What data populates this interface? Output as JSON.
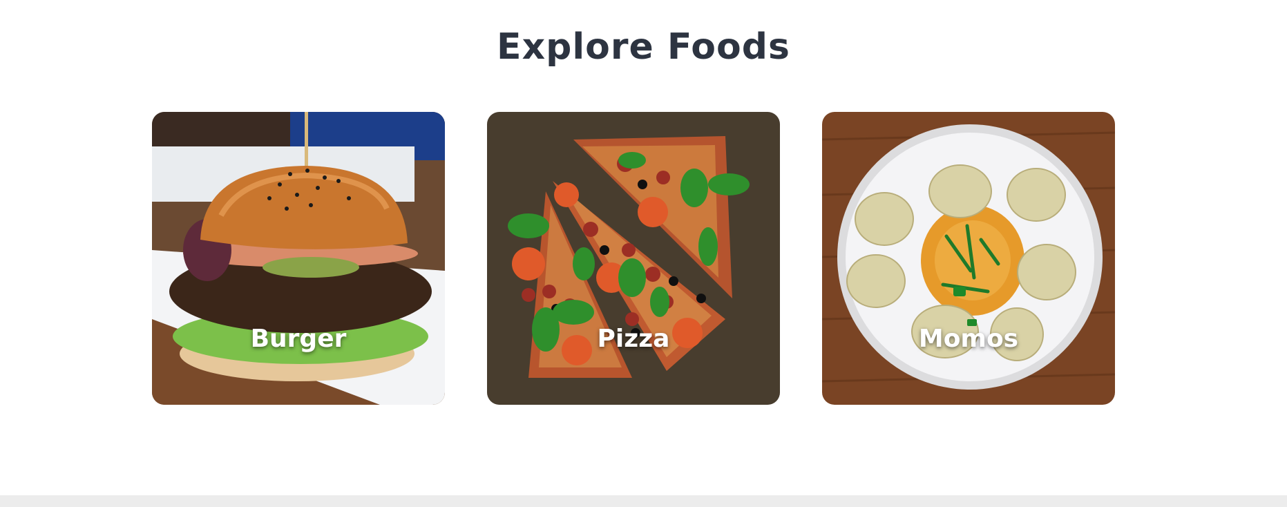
{
  "page": {
    "title": "Explore Foods"
  },
  "foods": [
    {
      "label": "Burger",
      "icon": "burger-image"
    },
    {
      "label": "Pizza",
      "icon": "pizza-image"
    },
    {
      "label": "Momos",
      "icon": "momos-image"
    }
  ],
  "colors": {
    "title": "#2d3441",
    "label": "#ffffff",
    "footer": "#ececec"
  }
}
